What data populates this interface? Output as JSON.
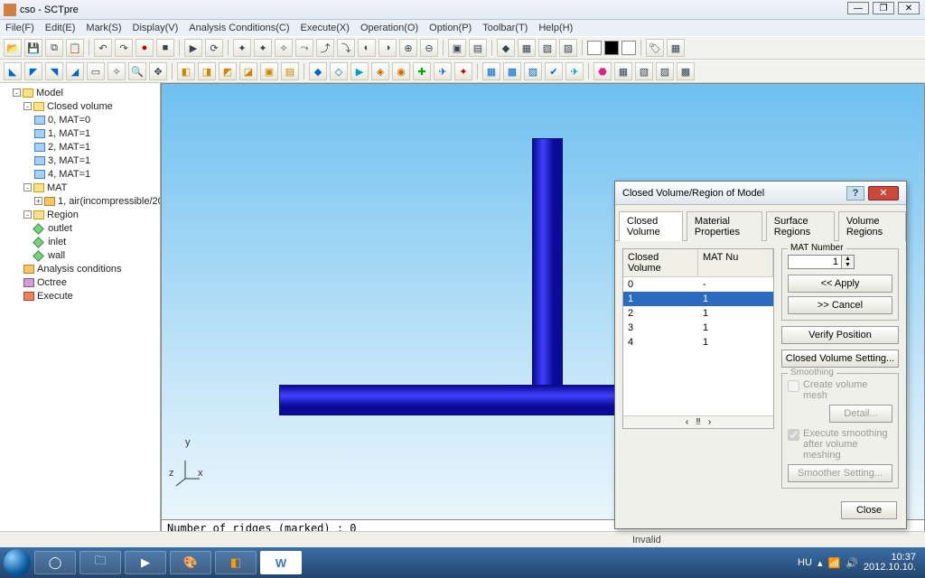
{
  "window": {
    "title": "cso - SCTpre"
  },
  "menu": [
    "File(F)",
    "Edit(E)",
    "Mark(S)",
    "Display(V)",
    "Analysis Conditions(C)",
    "Execute(X)",
    "Operation(O)",
    "Option(P)",
    "Toolbar(T)",
    "Help(H)"
  ],
  "tree": {
    "root": "Model",
    "closed_volume": "Closed volume",
    "cv_items": [
      "0, MAT=0",
      "1, MAT=1",
      "2, MAT=1",
      "3, MAT=1",
      "4, MAT=1"
    ],
    "mat": "MAT",
    "mat_item": "1, air(incompressible/20",
    "region": "Region",
    "regions": [
      "outlet",
      "inlet",
      "wall"
    ],
    "analysis": "Analysis conditions",
    "octree": "Octree",
    "execute": "Execute"
  },
  "axis": {
    "x": "x",
    "y": "y",
    "z": "z"
  },
  "log": "Number of ridges (marked)     :       0",
  "status": "Invalid",
  "dialog": {
    "title": "Closed Volume/Region of Model",
    "tabs": [
      "Closed Volume",
      "Material Properties",
      "Surface Regions",
      "Volume Regions"
    ],
    "grid_head": [
      "Closed Volume",
      "MAT Nu"
    ],
    "rows": [
      {
        "a": "0",
        "b": "-"
      },
      {
        "a": "1",
        "b": "1",
        "sel": true
      },
      {
        "a": "2",
        "b": "1"
      },
      {
        "a": "3",
        "b": "1"
      },
      {
        "a": "4",
        "b": "1"
      }
    ],
    "mat_label": "MAT Number",
    "mat_value": "1",
    "apply": "<< Apply",
    "cancel": ">> Cancel",
    "verify": "Verify Position",
    "cvsetting": "Closed Volume Setting...",
    "smooth_label": "Smoothing",
    "create_mesh": "Create volume mesh",
    "detail": "Detail...",
    "exec_smooth": "Execute smoothing after volume meshing",
    "smoother": "Smoother Setting...",
    "close": "Close"
  },
  "tray": {
    "lang": "HU",
    "time": "10:37",
    "date": "2012.10.10."
  }
}
